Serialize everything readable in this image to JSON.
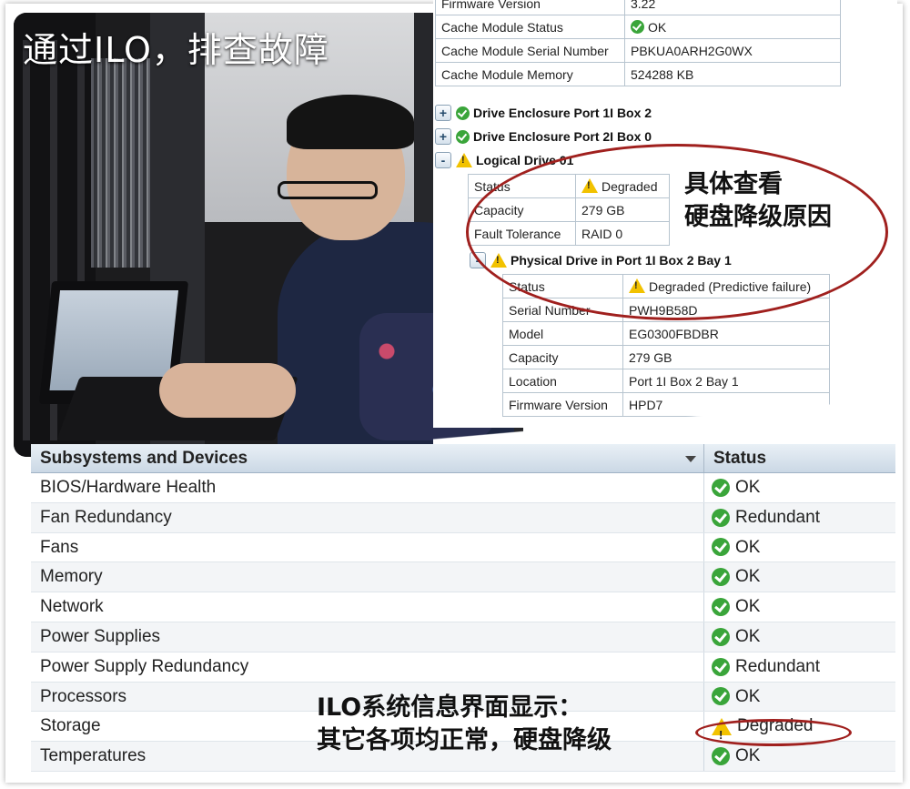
{
  "photo": {
    "caption": "通过ILO，排查故障"
  },
  "detail": {
    "controller_rows": [
      {
        "key": "Firmware Version",
        "value": "3.22"
      },
      {
        "key": "Cache Module Status",
        "value": "OK",
        "status": "ok"
      },
      {
        "key": "Cache Module Serial Number",
        "value": "PBKUA0ARH2G0WX"
      },
      {
        "key": "Cache Module Memory",
        "value": "524288 KB"
      }
    ],
    "tree": [
      {
        "toggle": "+",
        "status": "ok",
        "label": "Drive Enclosure Port 1I Box 2"
      },
      {
        "toggle": "+",
        "status": "ok",
        "label": "Drive Enclosure Port 2I Box 0"
      },
      {
        "toggle": "-",
        "status": "warn",
        "label": "Logical Drive 01"
      }
    ],
    "logical_rows": [
      {
        "key": "Status",
        "value": "Degraded",
        "status": "warn"
      },
      {
        "key": "Capacity",
        "value": "279 GB"
      },
      {
        "key": "Fault Tolerance",
        "value": "RAID 0"
      }
    ],
    "physical_header": {
      "toggle": "-",
      "status": "warn",
      "label": "Physical Drive in Port 1I Box 2 Bay 1"
    },
    "physical_rows": [
      {
        "key": "Status",
        "value": "Degraded (Predictive failure)",
        "status": "warn"
      },
      {
        "key": "Serial Number",
        "value": "PWH9B58D"
      },
      {
        "key": "Model",
        "value": "EG0300FBDBR"
      },
      {
        "key": "Capacity",
        "value": "279 GB"
      },
      {
        "key": "Location",
        "value": "Port 1I Box 2 Bay 1"
      },
      {
        "key": "Firmware Version",
        "value": "HPD7"
      }
    ],
    "annotation": {
      "line1": "具体查看",
      "line2": "硬盘降级原因"
    }
  },
  "subsystems": {
    "col_name": "Subsystems and Devices",
    "col_status": "Status",
    "rows": [
      {
        "name": "BIOS/Hardware Health",
        "status": "OK",
        "kind": "ok"
      },
      {
        "name": "Fan Redundancy",
        "status": "Redundant",
        "kind": "ok"
      },
      {
        "name": "Fans",
        "status": "OK",
        "kind": "ok"
      },
      {
        "name": "Memory",
        "status": "OK",
        "kind": "ok"
      },
      {
        "name": "Network",
        "status": "OK",
        "kind": "ok"
      },
      {
        "name": "Power Supplies",
        "status": "OK",
        "kind": "ok"
      },
      {
        "name": "Power Supply Redundancy",
        "status": "Redundant",
        "kind": "ok"
      },
      {
        "name": "Processors",
        "status": "OK",
        "kind": "ok"
      },
      {
        "name": "Storage",
        "status": "Degraded",
        "kind": "warn"
      },
      {
        "name": "Temperatures",
        "status": "OK",
        "kind": "ok"
      }
    ],
    "annotation": {
      "line1": "ILO系统信息界面显示：",
      "line2": "其它各项均正常，硬盘降级"
    }
  },
  "colors": {
    "ok": "#3aa53a",
    "warn": "#f2c200",
    "annotation": "#a0201e"
  }
}
